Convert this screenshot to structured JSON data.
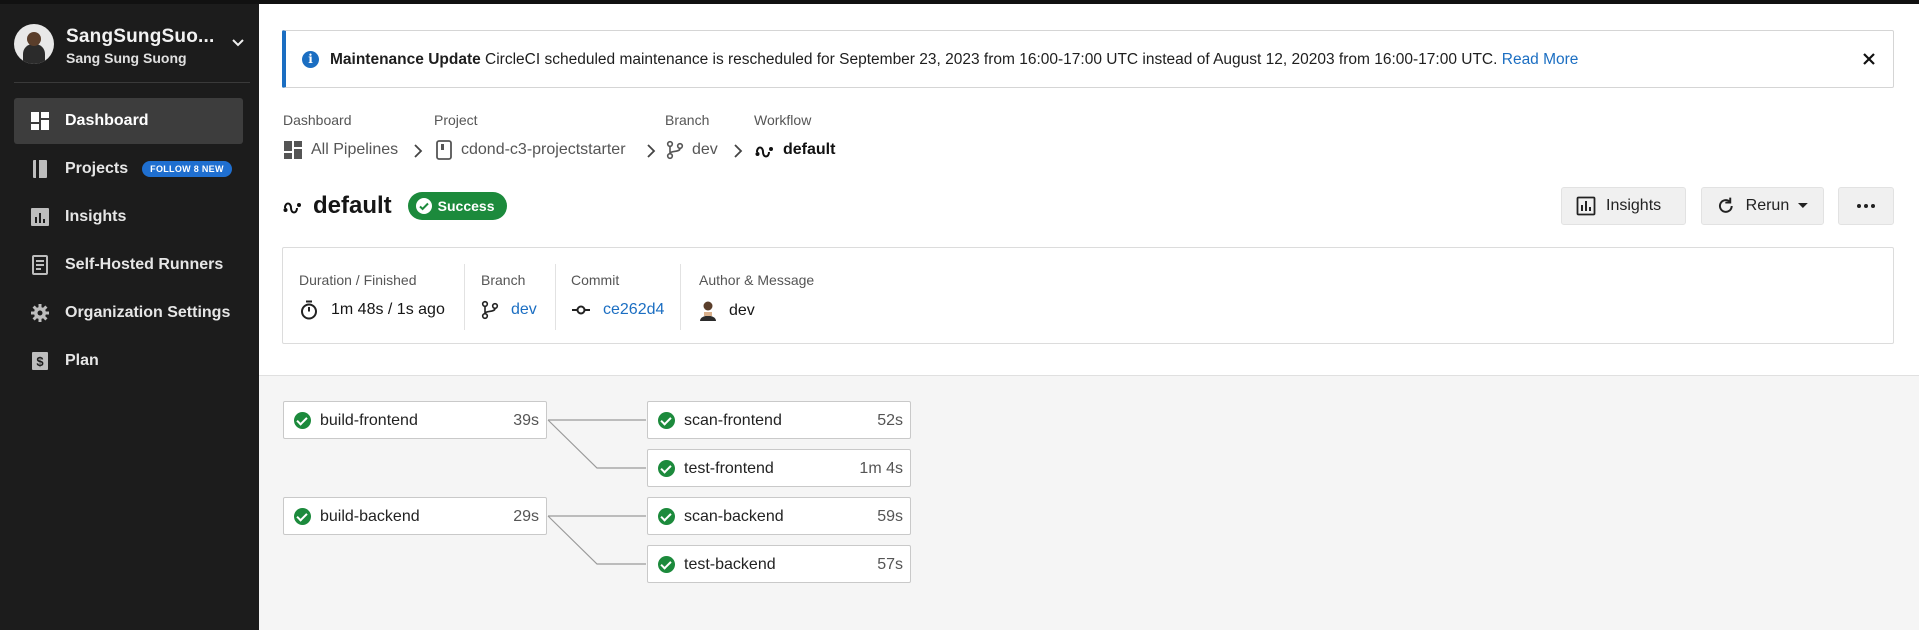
{
  "org": {
    "name": "SangSungSuo...",
    "subtitle": "Sang Sung Suong"
  },
  "sidebar": {
    "items": [
      {
        "label": "Dashboard",
        "icon": "dashboard-icon",
        "active": true
      },
      {
        "label": "Projects",
        "icon": "projects-icon",
        "badge": "FOLLOW 8 NEW"
      },
      {
        "label": "Insights",
        "icon": "insights-icon"
      },
      {
        "label": "Self-Hosted Runners",
        "icon": "runners-icon"
      },
      {
        "label": "Organization Settings",
        "icon": "gear-icon"
      },
      {
        "label": "Plan",
        "icon": "plan-icon"
      }
    ]
  },
  "alert": {
    "title": "Maintenance Update",
    "message": "CircleCI scheduled maintenance is rescheduled for September 23, 2023 from 16:00-17:00 UTC instead of August 12, 20203 from 16:00-17:00 UTC.",
    "link": "Read More"
  },
  "breadcrumb": {
    "labels": [
      "Dashboard",
      "Project",
      "Branch",
      "Workflow"
    ],
    "values": [
      "All Pipelines",
      "cdond-c3-projectstarter",
      "dev",
      "default"
    ]
  },
  "workflow": {
    "name": "default",
    "status": "Success"
  },
  "actions": {
    "insights": "Insights",
    "rerun": "Rerun"
  },
  "info": {
    "duration_label": "Duration / Finished",
    "duration_value": "1m 48s / 1s ago",
    "branch_label": "Branch",
    "branch_value": "dev",
    "commit_label": "Commit",
    "commit_value": "ce262d4",
    "author_label": "Author & Message",
    "author_value": "dev"
  },
  "jobs": [
    {
      "name": "build-frontend",
      "duration": "39s",
      "status": "success"
    },
    {
      "name": "scan-frontend",
      "duration": "52s",
      "status": "success"
    },
    {
      "name": "test-frontend",
      "duration": "1m 4s",
      "status": "success"
    },
    {
      "name": "build-backend",
      "duration": "29s",
      "status": "success"
    },
    {
      "name": "scan-backend",
      "duration": "59s",
      "status": "success"
    },
    {
      "name": "test-backend",
      "duration": "57s",
      "status": "success"
    }
  ],
  "colors": {
    "sidebar": "#1c1c1c",
    "accent": "#1b6ec2",
    "success": "#1c8a3c"
  }
}
